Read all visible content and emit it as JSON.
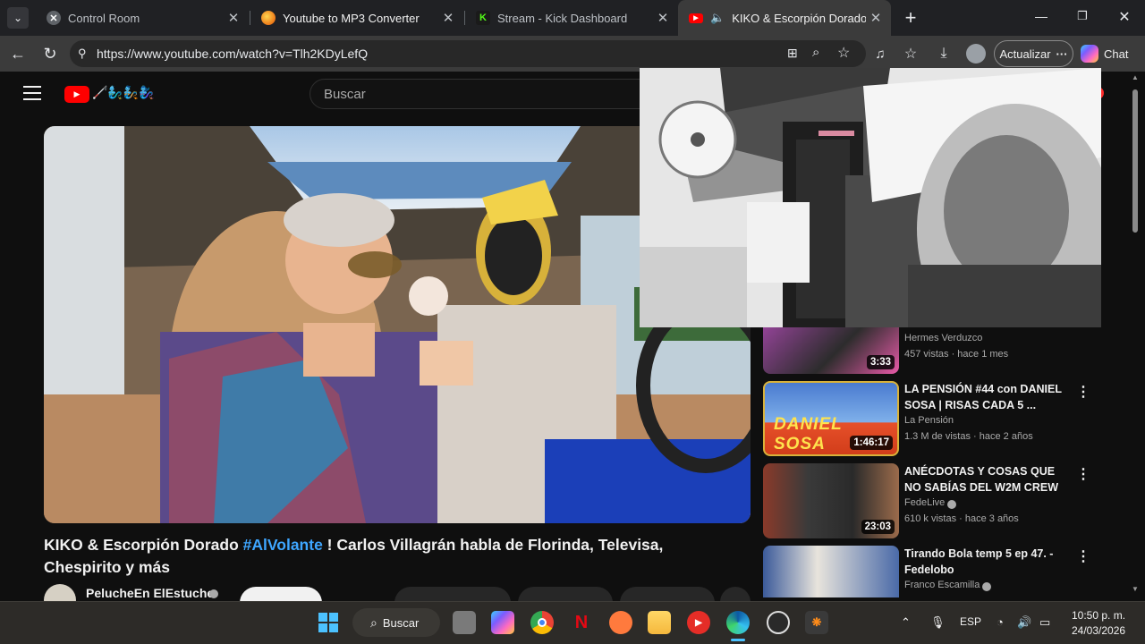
{
  "tabs": [
    {
      "title": "Control Room",
      "favicon": "control-room-favicon"
    },
    {
      "title": "Youtube to MP3 Converter",
      "favicon": "firefox-like-favicon"
    },
    {
      "title": "Stream - Kick Dashboard",
      "favicon": "kick-favicon",
      "favicon_letter": "K"
    },
    {
      "title": "KIKO & Escorpión Dorado #Al",
      "favicon": "youtube-favicon",
      "active": true
    }
  ],
  "address_bar": {
    "url": "https://www.youtube.com/watch?v=Tlh2KDyLefQ"
  },
  "toolbar": {
    "update_label": "Actualizar",
    "chat_label": "Chat"
  },
  "youtube": {
    "search_placeholder": "Buscar",
    "logo_emoji": "🦯🧞‍♂️🧞🧞‍♀️"
  },
  "video": {
    "title_part1": "KIKO & Escorpión Dorado ",
    "hashtag": "#AlVolante",
    "title_part2": " ! Carlos Villagrán habla de Florinda, Televisa, Chespirito y más",
    "channel_name": "PelucheEn ElEstuche"
  },
  "recommendations": [
    {
      "title": "",
      "channel": "Hermes Verduzco",
      "meta": "457 vistas · hace 1 mes",
      "duration": "3:33"
    },
    {
      "title": "LA PENSIÓN #44 con DANIEL SOSA | RISAS CADA 5 ...",
      "channel": "La Pensión",
      "meta": "1.3 M de vistas · hace 2 años",
      "duration": "1:46:17",
      "thumb_text": "DANIEL SOSA"
    },
    {
      "title": "ANÉCDOTAS Y COSAS QUE NO SABÍAS DEL W2M CREW",
      "channel": "FedeLive",
      "meta": "610 k vistas · hace 3 años",
      "duration": "23:03",
      "verified": true
    },
    {
      "title": "Tirando Bola temp 5 ep 47. - Fedelobo",
      "channel": "Franco Escamilla",
      "meta": "",
      "duration": "",
      "verified": true
    }
  ],
  "taskbar": {
    "search_label": "Buscar",
    "language": "ESP",
    "time": "10:50 p. m.",
    "date": "24/03/2026"
  },
  "colors": {
    "accent_link": "#3ea6ff",
    "youtube_red": "#ff0000",
    "tab_bg": "#202124",
    "active_tab_bg": "#3b3b3b"
  }
}
